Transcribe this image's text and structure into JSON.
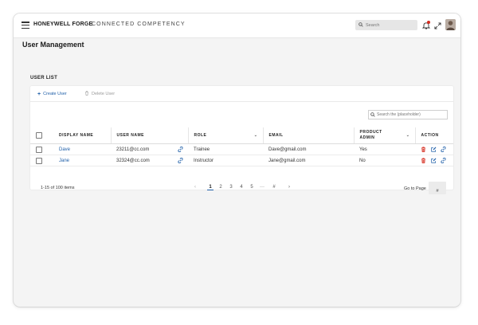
{
  "header": {
    "brand": "HONEYWELL FORGE",
    "product": "CONNECTED COMPETENCY",
    "search_placeholder": "Search"
  },
  "page": {
    "title": "User Management",
    "section_title": "USER LIST"
  },
  "toolbar": {
    "create_label": "Create User",
    "delete_label": "Delete User"
  },
  "table_search": {
    "placeholder": "Search the (placeholder)"
  },
  "table": {
    "columns": {
      "display_name": "DISPLAY NAME",
      "user_name": "USER NAME",
      "role": "ROLE",
      "email": "EMAIL",
      "product_admin_line1": "PRODUCT",
      "product_admin_line2": "ADMIN",
      "action": "ACTION"
    },
    "rows": [
      {
        "display_name": "Dave",
        "user_name": "23211@cc.com",
        "role": "Trainee",
        "email": "Dave@gmail.com",
        "product_admin": "Yes"
      },
      {
        "display_name": "Jane",
        "user_name": "32324@cc.com",
        "role": "Instructor",
        "email": "Jane@gmail.com",
        "product_admin": "No"
      }
    ]
  },
  "footer": {
    "count_text": "1-15 of 100 items",
    "pages": [
      "1",
      "2",
      "3",
      "4",
      "5",
      "···",
      "#"
    ],
    "active_page": "1",
    "prev_icon": "‹",
    "next_icon": "›",
    "goto_label": "Go to Page",
    "goto_value": "#"
  },
  "colors": {
    "accent": "#1f5fa8",
    "delete_red": "#d52b1e",
    "notification_dot": "#d52b1e"
  },
  "icons": [
    "hamburger-icon",
    "search-icon",
    "bell-icon",
    "expand-icon",
    "avatar",
    "plus-icon",
    "trash-icon",
    "copy-icon",
    "chevron-down-icon",
    "edit-icon",
    "link-icon",
    "chevron-left-icon",
    "chevron-right-icon"
  ]
}
